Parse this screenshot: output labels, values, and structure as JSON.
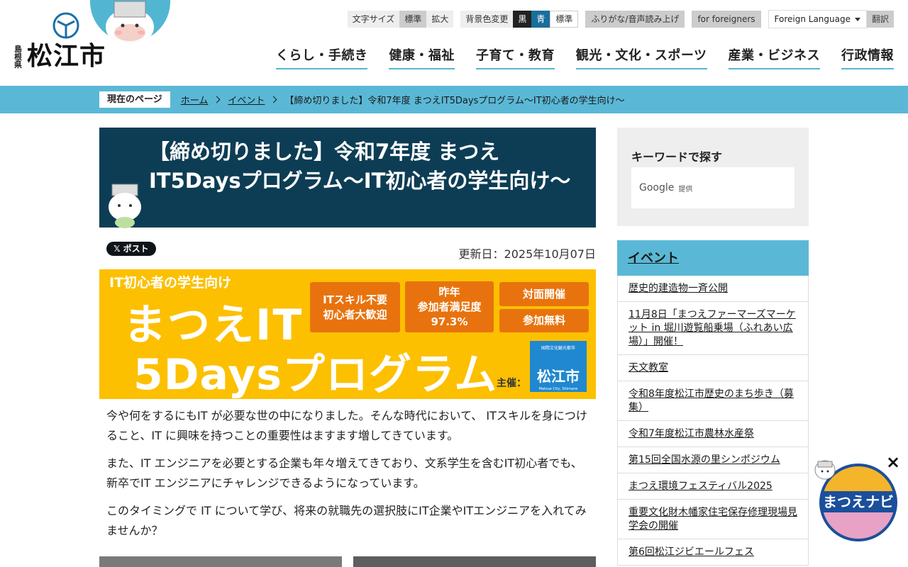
{
  "header": {
    "logo_pref": "島根県",
    "logo_city": "松江市",
    "utility": {
      "font_size_label": "文字サイズ",
      "font_standard": "標準",
      "font_large": "拡大",
      "bg_label": "背景色変更",
      "bg_black": "黒",
      "bg_blue": "青",
      "bg_standard": "標準",
      "furigana": "ふりがな/音声読み上げ",
      "foreigners": "for foreigners",
      "foreign_language": "Foreign Language",
      "translate": "翻訳"
    },
    "nav": [
      "くらし・手続き",
      "健康・福祉",
      "子育て・教育",
      "観光・文化・スポーツ",
      "産業・ビジネス",
      "行政情報"
    ]
  },
  "breadcrumb": {
    "label": "現在のページ",
    "home": "ホーム",
    "events": "イベント",
    "current": "【締め切りました】令和7年度 まつえIT5Daysプログラム～IT初心者の学生向け～"
  },
  "article": {
    "title": "【締め切りました】令和7年度 まつえIT5Daysプログラム～IT初心者の学生向け～",
    "x_post": "ポスト",
    "x_glyph": "𝕏",
    "updated": "更新日：2025年10月07日",
    "banner": {
      "subtitle": "IT初心者の学生向け",
      "main_line1": "まつえIT",
      "main_line2": "5Daysプログラム",
      "box1": "ITスキル不要\n初心者大歓迎",
      "box2": "昨年\n参加者満足度\n97.3%",
      "box3": "対面開催",
      "box4": "参加無料",
      "organizer_label": "主催：",
      "org_logo_small": "国際文化観光都市",
      "org_logo_name": "松江市",
      "org_logo_en": "Matsue City, Shimane"
    },
    "paragraphs": [
      "今や何をするにもIT が必要な世の中になりました。そんな時代において、 ITスキルを身につけること、IT に興味を持つことの重要性はますます増してきています。",
      "また、IT エンジニアを必要とする企業も年々増えてきており、文系学生を含むIT初心者でも、新卒でIT エンジニアにチャレンジできるようになっています。",
      "このタイミングで IT について学び、将来の就職先の選択肢にIT企業やITエンジニアを入れてみませんか？"
    ]
  },
  "sidebar": {
    "search_title": "キーワードで探す",
    "search_google": "Google",
    "search_powered": "提供",
    "events_heading": "イベント",
    "events": [
      "歴史的建造物一斉公開",
      "11月8日「まつえファーマーズマーケット in 堀川遊覧船乗場（ふれあい広場）」開催！",
      "天文教室",
      "令和8年度松江市歴史のまち歩き（募集）",
      "令和7年度松江市農林水産祭",
      "第15回全国水源の里シンポジウム",
      "まつえ環境フェスティバル2025",
      "重要文化財木幡家住宅保存修理現場見学会の開催",
      "第6回松江ジビエールフェス"
    ]
  },
  "floating": {
    "close": "×",
    "navi_label": "まつえナビ"
  },
  "colors": {
    "accent": "#5ab8d6",
    "title_bg": "#0d3d54",
    "banner_bg": "#fcc000",
    "banner_box": "#e8730e"
  }
}
